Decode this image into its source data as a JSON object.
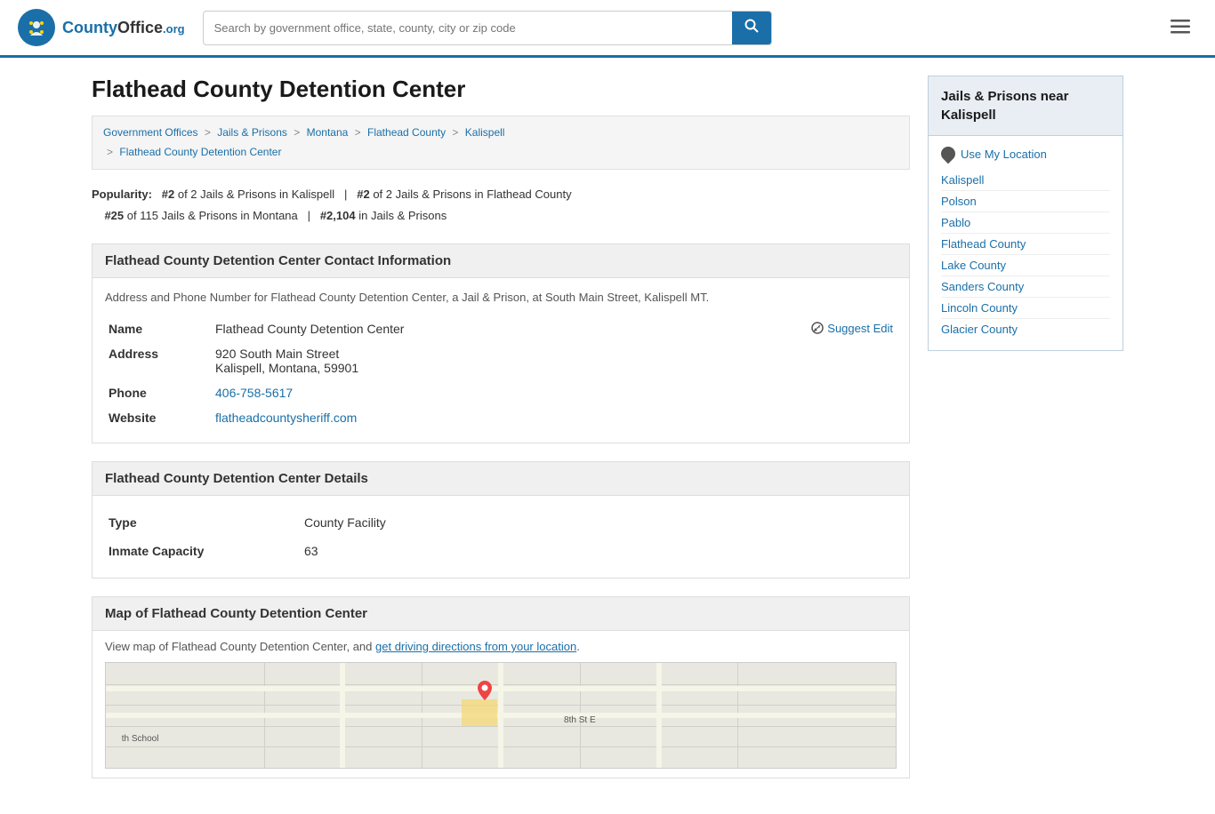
{
  "header": {
    "logo_text": "County",
    "logo_org": "Office",
    "logo_tld": ".org",
    "search_placeholder": "Search by government office, state, county, city or zip code",
    "search_button_label": "🔍"
  },
  "page": {
    "title": "Flathead County Detention Center"
  },
  "breadcrumb": {
    "items": [
      {
        "label": "Government Offices",
        "href": "#"
      },
      {
        "label": "Jails & Prisons",
        "href": "#"
      },
      {
        "label": "Montana",
        "href": "#"
      },
      {
        "label": "Flathead County",
        "href": "#"
      },
      {
        "label": "Kalispell",
        "href": "#"
      },
      {
        "label": "Flathead County Detention Center",
        "href": "#"
      }
    ]
  },
  "popularity": {
    "label": "Popularity:",
    "stat1": "#2",
    "stat1_text": "of 2 Jails & Prisons in Kalispell",
    "stat2": "#2",
    "stat2_text": "of 2 Jails & Prisons in Flathead County",
    "stat3": "#25",
    "stat3_text": "of 115 Jails & Prisons in Montana",
    "stat4": "#2,104",
    "stat4_text": "in Jails & Prisons"
  },
  "contact": {
    "section_title": "Flathead County Detention Center Contact Information",
    "description": "Address and Phone Number for Flathead County Detention Center, a Jail & Prison, at South Main Street, Kalispell MT.",
    "name_label": "Name",
    "name_value": "Flathead County Detention Center",
    "address_label": "Address",
    "address_line1": "920 South Main Street",
    "address_line2": "Kalispell, Montana, 59901",
    "phone_label": "Phone",
    "phone_value": "406-758-5617",
    "website_label": "Website",
    "website_value": "flatheadcountysheriff.com",
    "suggest_edit_label": "Suggest Edit"
  },
  "details": {
    "section_title": "Flathead County Detention Center Details",
    "type_label": "Type",
    "type_value": "County Facility",
    "capacity_label": "Inmate Capacity",
    "capacity_value": "63"
  },
  "map": {
    "section_title": "Map of Flathead County Detention Center",
    "description": "View map of Flathead County Detention Center, and ",
    "link_text": "get driving directions from your location",
    "map_label1": "th School",
    "map_label2": "8th St E"
  },
  "sidebar": {
    "header": "Jails & Prisons near Kalispell",
    "use_my_location": "Use My Location",
    "links": [
      {
        "label": "Kalispell"
      },
      {
        "label": "Polson"
      },
      {
        "label": "Pablo"
      },
      {
        "label": "Flathead County"
      },
      {
        "label": "Lake County"
      },
      {
        "label": "Sanders County"
      },
      {
        "label": "Lincoln County"
      },
      {
        "label": "Glacier County"
      }
    ]
  }
}
